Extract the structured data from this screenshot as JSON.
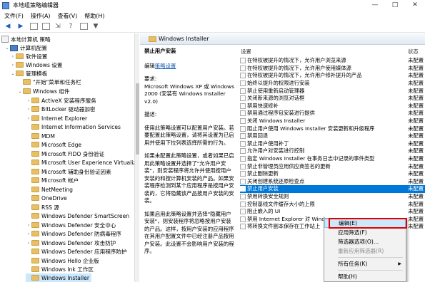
{
  "window": {
    "title": "本地组策略编辑器",
    "minimize": "—",
    "maximize": "□",
    "close": "✕"
  },
  "menu": [
    "文件(F)",
    "操作(A)",
    "查看(V)",
    "帮助(H)"
  ],
  "tree": {
    "root": "本地计算机 策略",
    "computer_config": "计算机配置",
    "software_settings": "软件设置",
    "windows_settings": "Windows 设置",
    "admin_templates": "管理模板",
    "start_menu": "\"开始\"菜单和任务栏",
    "windows_components": "Windows 组件",
    "items": [
      "ActiveX 安装程序服务",
      "BitLocker 驱动器加密",
      "Internet Explorer",
      "Internet Information Services",
      "MDM",
      "Microsoft Edge",
      "Microsoft FIDO 身份验证",
      "Microsoft User Experience Virtualiz",
      "Microsoft 辅助身份验证因素",
      "Microsoft 帐户",
      "NetMeeting",
      "OneDrive",
      "RSS 源",
      "Windows Defender SmartScreen",
      "Windows Defender 安全中心",
      "Windows Defender 防病毒程序",
      "Windows Defender 攻击防护",
      "Windows Defender 应用程序防护",
      "Windows Hello 企业版",
      "Windows Ink 工作区",
      "Windows Installer"
    ]
  },
  "right": {
    "header": "Windows Installer",
    "desc_title": "禁止用户安装",
    "edit_prefix": "编辑",
    "edit_link": "策略设置",
    "req_label": "要求:",
    "req_text": "Microsoft Windows XP 或 Windows 2000 (安装有 Windows Installer v2.0)",
    "desc_label": "描述:",
    "desc1": "使用此策略设置可以配置用户安装。若要配置此策略设置，请将其设置为已启用并使用下拉列表选择所需的行为。",
    "desc2": "如果未配置此策略设置，或者如果已启用此策略设置并选择了\"允许用户安装\"，则安装程序将允许并使用按用户安装的和按计算机安装的产品。如果安装程序检测到某个应用程序是按用户安装的，它将隐藏该产品按用户安装的安装。",
    "desc3": "如果启用此策略设置并选择\"隐藏用户安装\"，则安装程序将忽略按用户安装的产品。这样，按用户安装的应用程序在其用户配置文件中已经注册产品按用户安装。此设置不会影响用户安装的程序。"
  },
  "columns": {
    "setting": "设置",
    "state": "状态"
  },
  "settings": [
    {
      "name": "在特权被提升的情况下，允许用户浏览来源",
      "state": "未配置"
    },
    {
      "name": "在特权被提升的情况下，允许用户使用媒体源",
      "state": "未配置"
    },
    {
      "name": "在特权被提升的情况下，允许用户修补提升的产品",
      "state": "未配置"
    },
    {
      "name": "始终以提升的权限进行安装",
      "state": "未配置"
    },
    {
      "name": "禁止使用重新启动管理器",
      "state": "未配置"
    },
    {
      "name": "关闭新来源的浏览对话框",
      "state": "未配置"
    },
    {
      "name": "禁用快速修补",
      "state": "未配置"
    },
    {
      "name": "禁用通过程序包安装进行提供",
      "state": "未配置"
    },
    {
      "name": "关闭 Windows Installer",
      "state": "未配置"
    },
    {
      "name": "阻止用户使用 Windows Installer 安装更新和升级程序",
      "state": "未配置"
    },
    {
      "name": "禁用回退",
      "state": "未配置"
    },
    {
      "name": "禁止用户使用补丁",
      "state": "未配置"
    },
    {
      "name": "允许用户对安装进行控制",
      "state": "未配置"
    },
    {
      "name": "指定 Windows Installer 在事务日志中记录的事件类型",
      "state": "未配置"
    },
    {
      "name": "禁止非管理员应用供应商签名的更新",
      "state": "未配置"
    },
    {
      "name": "禁止删除更新",
      "state": "未配置"
    },
    {
      "name": "关闭创建系统还原检查点",
      "state": "未配置"
    },
    {
      "name": "禁止用户安装",
      "state": "未配置"
    },
    {
      "name": "禁用转换安全规则",
      "state": "未配置"
    },
    {
      "name": "控制基线文件缓存大小的上限",
      "state": "未配置"
    },
    {
      "name": "阻止嵌入的 UI",
      "state": "未配置"
    },
    {
      "name": "禁用 Internet Explorer 对 Windows",
      "state": "未配置"
    },
    {
      "name": "将转换文件副本保存在工作站上",
      "state": "未配置"
    }
  ],
  "context_menu": {
    "edit": "编辑(E)",
    "filter_on": "应用筛选(F)",
    "filter_options": "筛选器选项(O)...",
    "reapply": "重新应用筛选器(R)",
    "all_tasks": "所有任务(K)",
    "help": "帮助(H)"
  }
}
